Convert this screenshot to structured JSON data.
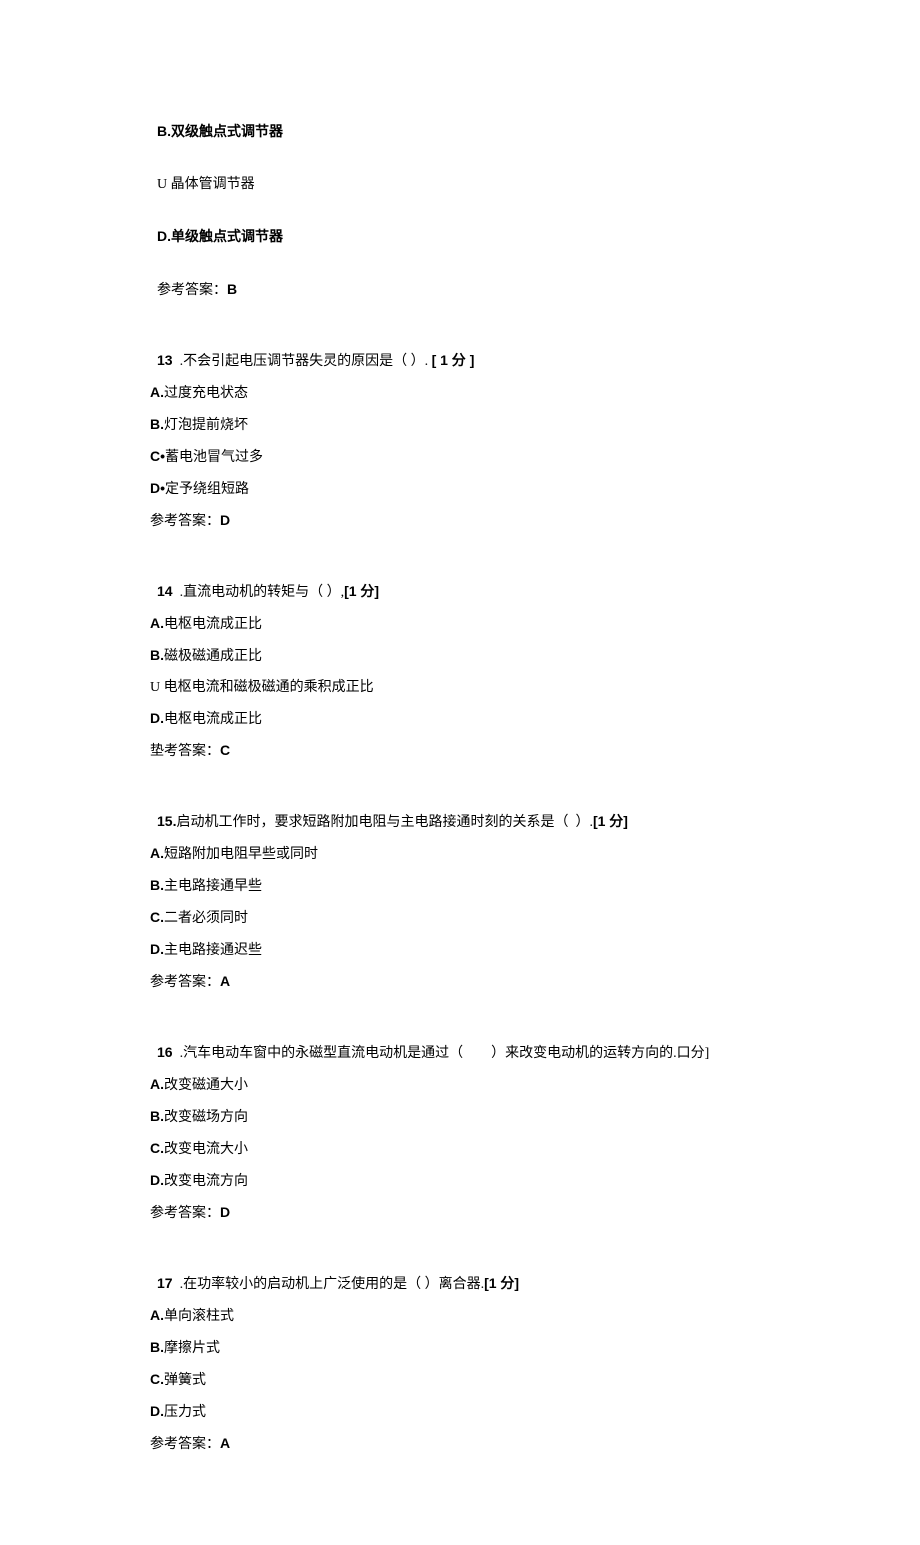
{
  "prev_options": {
    "B": "B.双级触点式调节器",
    "C": "U 晶体管调节器",
    "D": "D.单级触点式调节器",
    "answer_label": "参考答案：",
    "answer_value": "B"
  },
  "questions": [
    {
      "num": "13",
      "stem_prefix": "  .不会引起电压调节器失灵的原因是（ ）. ",
      "score": "[ 1 分 ]",
      "options": [
        {
          "label": "A.",
          "text": "过度充电状态"
        },
        {
          "label": "B.",
          "text": "灯泡提前烧坏"
        },
        {
          "label": "C•",
          "text": "蓄电池冒气过多"
        },
        {
          "label": "D•",
          "text": "定予绕组短路"
        }
      ],
      "answer_label": "参考答案：",
      "answer_value": "D"
    },
    {
      "num": "14",
      "stem_prefix": "  .直流电动机的转矩与（ ）,",
      "score": "[1 分]",
      "options": [
        {
          "label": "A.",
          "text": "电枢电流成正比"
        },
        {
          "label": "B.",
          "text": "磁极磁通成正比"
        },
        {
          "label": "U ",
          "text": "电枢电流和磁极磁通的乘积成正比"
        },
        {
          "label": "D.",
          "text": "电枢电流成正比"
        }
      ],
      "answer_label": "垫考答案：",
      "answer_value": "C"
    },
    {
      "num": "15.",
      "stem_prefix": "启动机工作时，要求短路附加电阻与主电路接通时刻的关系是（  ）.",
      "score": "[1 分]",
      "options": [
        {
          "label": "A.",
          "text": "短路附加电阻早些或同时"
        },
        {
          "label": "B.",
          "text": "主电路接通早些"
        },
        {
          "label": "C.",
          "text": "二者必须同时"
        },
        {
          "label": "D.",
          "text": "主电路接通迟些"
        }
      ],
      "answer_label": "参考答案：",
      "answer_value": "A"
    },
    {
      "num": "16",
      "stem_prefix": "  .汽车电动车窗中的永磁型直流电动机是通过（        ）来改变电动机的运转方向的.口分]",
      "score": "",
      "options": [
        {
          "label": "A.",
          "text": "改变磁通大小"
        },
        {
          "label": "B.",
          "text": "改变磁场方向"
        },
        {
          "label": "C.",
          "text": "改变电流大小"
        },
        {
          "label": "D.",
          "text": "改变电流方向"
        }
      ],
      "answer_label": "参考答案：",
      "answer_value": "D"
    },
    {
      "num": "17",
      "stem_prefix": "  .在功率较小的启动机上广泛使用的是（ ）离合器.",
      "score": "[1 分]",
      "options": [
        {
          "label": "A.",
          "text": "单向滚柱式"
        },
        {
          "label": "B.",
          "text": "摩擦片式"
        },
        {
          "label": "C.",
          "text": "弹簧式"
        },
        {
          "label": "D.",
          "text": "压力式"
        }
      ],
      "answer_label": "参考答案：",
      "answer_value": "A"
    }
  ]
}
